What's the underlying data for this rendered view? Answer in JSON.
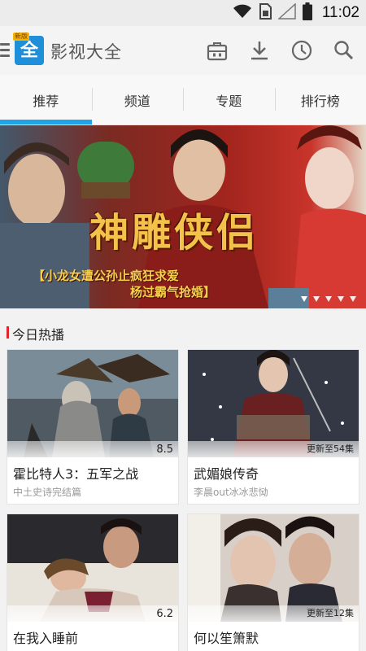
{
  "status_bar": {
    "time": "11:02",
    "icons": [
      "wifi-icon",
      "sim-icon",
      "signal-icon",
      "battery-icon"
    ]
  },
  "app_bar": {
    "logo_text": "全",
    "logo_tag": "新版",
    "title": "影视大全",
    "actions": [
      "store-icon",
      "download-icon",
      "history-clock-icon",
      "search-icon"
    ]
  },
  "tabs": [
    {
      "label": "推荐",
      "active": true
    },
    {
      "label": "频道",
      "active": false
    },
    {
      "label": "专题",
      "active": false
    },
    {
      "label": "排行榜",
      "active": false
    }
  ],
  "banner": {
    "title": "神雕侠侣",
    "caption_line1": "【小龙女遭公孙止疯狂求爱",
    "caption_line2": "杨过霸气抢婚】",
    "dots": 5,
    "active_dot": 0
  },
  "section": {
    "title": "今日热播"
  },
  "cards": [
    {
      "title": "霍比特人3：五军之战",
      "subtitle": "中土史诗完结篇",
      "badge": "8.5"
    },
    {
      "title": "武媚娘传奇",
      "subtitle": "李晨out冰冰悲恸",
      "badge": "更新至54集"
    },
    {
      "title": "在我入睡前",
      "subtitle": "",
      "badge": "6.2"
    },
    {
      "title": "何以笙箫默",
      "subtitle": "",
      "badge": "更新至12集"
    }
  ],
  "colors": {
    "accent": "#1ea2e8",
    "section_marker": "#e0252b",
    "logo": "#1e8fd8"
  }
}
